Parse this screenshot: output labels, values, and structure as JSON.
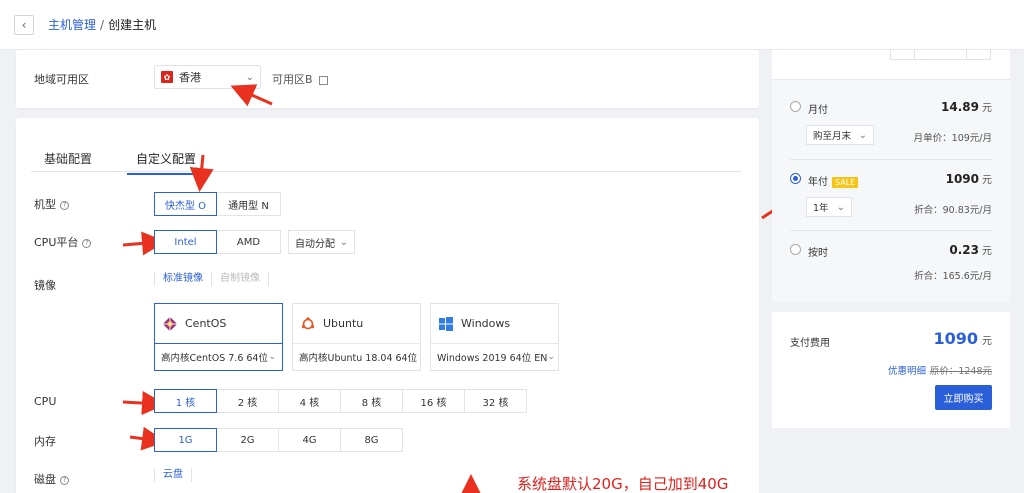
{
  "breadcrumb": {
    "parent": "主机管理",
    "separator": "/",
    "current": "创建主机"
  },
  "region": {
    "label": "地域可用区",
    "value": "香港",
    "zone": "可用区B"
  },
  "tabs": [
    {
      "label": "基础配置"
    },
    {
      "label": "自定义配置"
    }
  ],
  "machine_type": {
    "label": "机型",
    "options": [
      "快杰型 O",
      "通用型 N"
    ],
    "selected": "快杰型 O"
  },
  "cpu_platform": {
    "label": "CPU平台",
    "options": [
      "Intel",
      "AMD"
    ],
    "selected": "Intel",
    "allocation": "自动分配"
  },
  "image": {
    "label": "镜像",
    "subtabs": [
      "标准镜像",
      "自制镜像"
    ],
    "os": [
      {
        "name": "CentOS",
        "version": "高内核CentOS 7.6 64位"
      },
      {
        "name": "Ubuntu",
        "version": "高内核Ubuntu 18.04 64位"
      },
      {
        "name": "Windows",
        "version": "Windows 2019 64位 EN"
      }
    ],
    "selected": "CentOS"
  },
  "cpu": {
    "label": "CPU",
    "options": [
      "1 核",
      "2 核",
      "4 核",
      "8 核",
      "16 核",
      "32 核"
    ],
    "selected": "1 核"
  },
  "memory": {
    "label": "内存",
    "options": [
      "1G",
      "2G",
      "4G",
      "8G"
    ],
    "selected": "1G"
  },
  "disk": {
    "label": "磁盘",
    "subtab": "云盘"
  },
  "annotation": {
    "text": "系统盘默认20G，自己加到40G",
    "color": "#e0201c"
  },
  "pricing": {
    "plans": [
      {
        "name": "月付",
        "price": "14.89",
        "unit": "元",
        "period": "购至月末",
        "note": "月单价：109元/月"
      },
      {
        "name": "年付",
        "badge": "SALE",
        "price": "1090",
        "unit": "元",
        "period": "1年",
        "note": "折合：90.83元/月"
      },
      {
        "name": "按时",
        "price": "0.23",
        "unit": "元",
        "note": "折合：165.6元/月"
      }
    ],
    "selected": "年付"
  },
  "payment": {
    "label": "支付费用",
    "total": "1090",
    "unit": "元",
    "details_link": "优惠明细",
    "original": "原价：1248元",
    "buy_label": "立即购买"
  },
  "colors": {
    "accent": "#2b5fd9",
    "arrow": "#e8321f",
    "sale": "#f5c518"
  }
}
